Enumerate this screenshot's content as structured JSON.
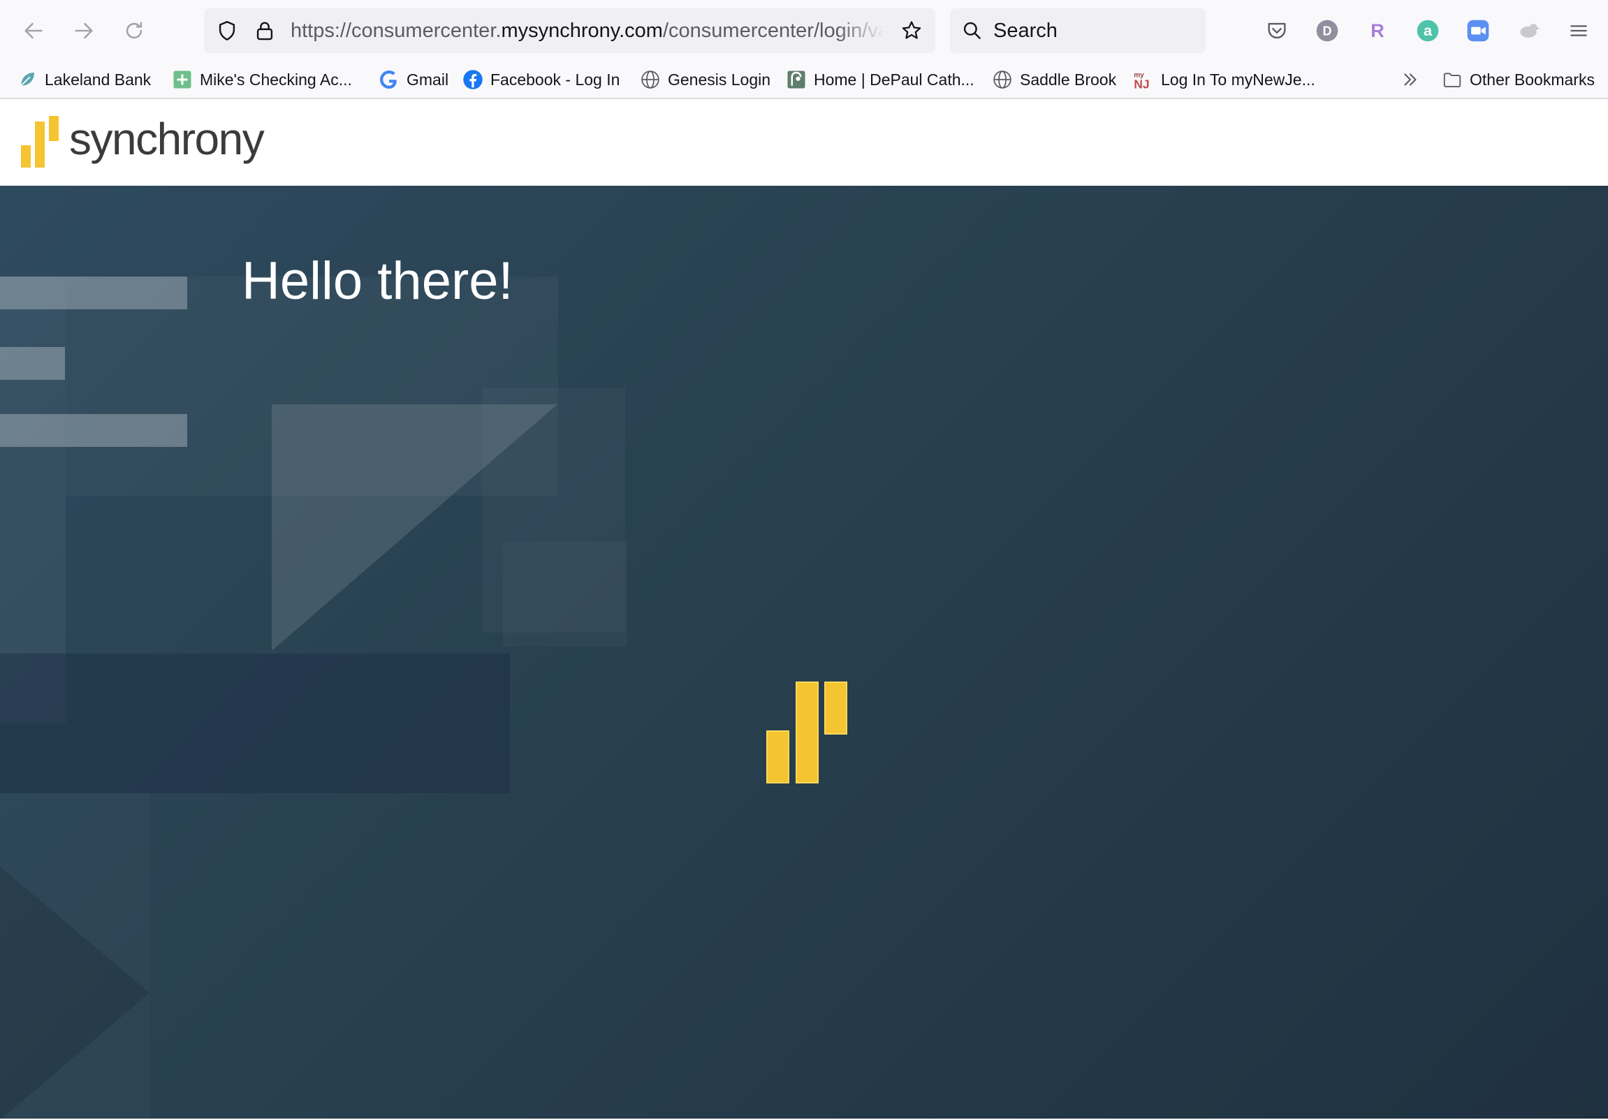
{
  "browser": {
    "url_prefix": "https://consumercenter.",
    "url_host": "mysynchrony.com",
    "url_path": "/consumercenter/login/val",
    "search_placeholder": "Search",
    "extensions": [
      {
        "name": "pocket-icon"
      },
      {
        "name": "profile-d-icon",
        "letter": "D"
      },
      {
        "name": "extension-r-icon",
        "letter": "R"
      },
      {
        "name": "extension-a-icon",
        "letter": "a"
      },
      {
        "name": "zoom-icon"
      },
      {
        "name": "extension-bird-icon"
      }
    ]
  },
  "bookmarks": {
    "items": [
      {
        "label": "Lakeland Bank"
      },
      {
        "label": "Mike's Checking Ac..."
      },
      {
        "label": "Gmail"
      },
      {
        "label": "Facebook - Log In"
      },
      {
        "label": "Genesis Login"
      },
      {
        "label": "Home | DePaul Cath..."
      },
      {
        "label": "Saddle Brook"
      },
      {
        "label": "Log In To myNewJe..."
      }
    ],
    "other_label": "Other Bookmarks"
  },
  "site": {
    "brand_name": "synchrony",
    "brand_color": "#f4c431"
  },
  "hero": {
    "title": "Hello there!"
  },
  "colors": {
    "hero_bg": "#28404f",
    "accent_yellow": "#f4c431"
  }
}
